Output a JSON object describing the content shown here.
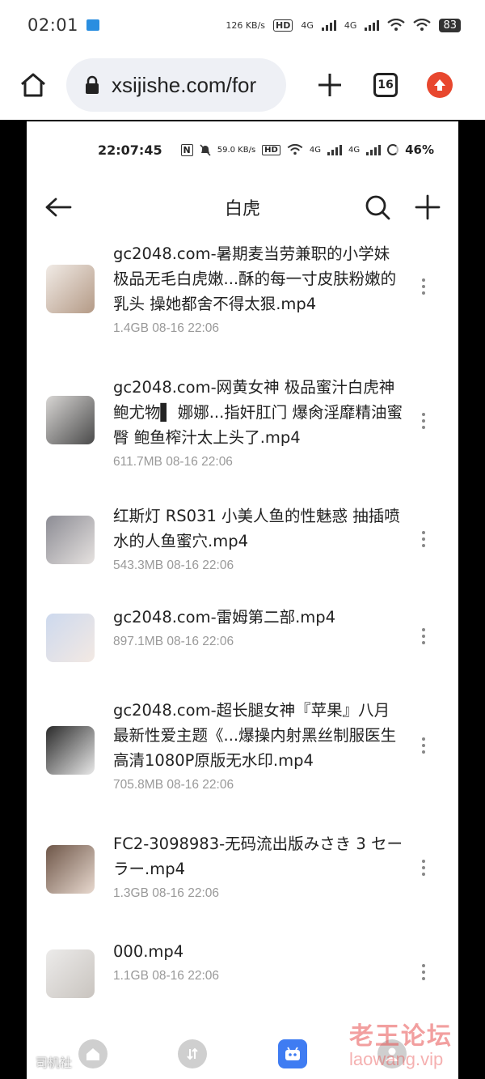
{
  "outer_status": {
    "time": "02:01",
    "net_speed": "126 KB/s",
    "hd_label": "HD",
    "sig1": "4G",
    "sig2": "4G",
    "battery": "83"
  },
  "browser": {
    "url": "xsijishe.com/for",
    "tab_count": "16"
  },
  "inner_status": {
    "time": "22:07:45",
    "net_speed": "59.0 KB/s",
    "hd_label": "HD",
    "sig1": "4G",
    "sig2": "4G",
    "battery": "46%"
  },
  "app_header": {
    "title": "白虎"
  },
  "files": [
    {
      "name": "gc2048.com-暑期麦当劳兼职的小学妹 极品无毛白虎嫩...酥的每一寸皮肤粉嫩的乳头 操她都舍不得太狠.mp4",
      "meta": "1.4GB  08-16 22:06"
    },
    {
      "name": "gc2048.com-网黄女神 极品蜜汁白虎神鲍尤物▌ 娜娜...指奸肛门 爆肏淫靡精油蜜臀 鲍鱼榨汁太上头了.mp4",
      "meta": "611.7MB  08-16 22:06"
    },
    {
      "name": "红斯灯 RS031 小美人鱼的性魅惑 抽插喷水的人鱼蜜穴.mp4",
      "meta": "543.3MB  08-16 22:06"
    },
    {
      "name": "gc2048.com-雷姆第二部.mp4",
      "meta": "897.1MB  08-16 22:06"
    },
    {
      "name": "gc2048.com-超长腿女神『苹果』八月最新性爱主题《...爆操内射黑丝制服医生 高清1080P原版无水印.mp4",
      "meta": "705.8MB  08-16 22:06"
    },
    {
      "name": "FC2-3098983-无码流出版みさき 3 セーラー.mp4",
      "meta": "1.3GB  08-16 22:06"
    },
    {
      "name": "000.mp4",
      "meta": "1.1GB  08-16 22:06"
    }
  ],
  "watermark": {
    "main": "老王论坛",
    "sub": "laowang.vip",
    "left": "司机社"
  },
  "colors": {
    "accent": "#3f7cf2",
    "upload_red": "#e8472e",
    "meta_gray": "#999999"
  }
}
